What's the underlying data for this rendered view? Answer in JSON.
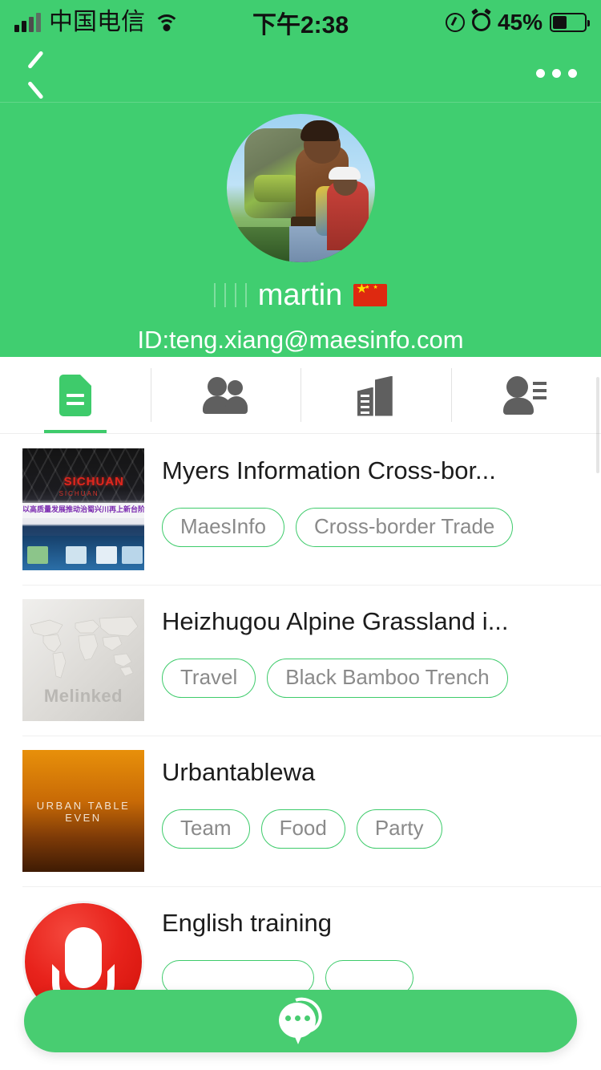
{
  "status_bar": {
    "carrier": "中国电信",
    "time": "下午2:38",
    "battery_percent": "45%",
    "icons": [
      "signal-icon",
      "wifi-icon",
      "location-icon",
      "alarm-icon",
      "battery-icon"
    ]
  },
  "nav_bar": {
    "back_label": "",
    "more_label": ""
  },
  "profile": {
    "username": "martin",
    "flag": "cn-flag",
    "user_id": "ID:teng.xiang@maesinfo.com"
  },
  "tabs": [
    {
      "name": "tab-documents",
      "icon": "document-icon",
      "active": true
    },
    {
      "name": "tab-groups",
      "icon": "people-icon",
      "active": false
    },
    {
      "name": "tab-company",
      "icon": "building-icon",
      "active": false
    },
    {
      "name": "tab-contact",
      "icon": "contact-card-icon",
      "active": false
    }
  ],
  "list": [
    {
      "title": "Myers Information Cross-bor...",
      "thumb": "expo-hall-photo",
      "thumb_logo": "SICHUAN",
      "thumb_banner": "以高质量发展推动治蜀兴川再上新台阶",
      "tags": [
        "MaesInfo",
        "Cross-border Trade"
      ]
    },
    {
      "title": "Heizhugou Alpine Grassland i...",
      "thumb": "world-map-placeholder",
      "thumb_watermark": "Melinked",
      "tags": [
        "Travel",
        "Black Bamboo Trench"
      ]
    },
    {
      "title": "Urbantablewa",
      "thumb": "urban-table-gradient",
      "thumb_caption": "URBAN TABLE EVEN",
      "tags": [
        "Team",
        "Food",
        "Party"
      ]
    },
    {
      "title": "English training",
      "thumb": "microphone-avatar",
      "tags": [
        "",
        ""
      ]
    }
  ],
  "chat_button": {
    "icon": "chat-bubble-icon",
    "label": ""
  },
  "colors": {
    "brand_green": "#40ce70",
    "tab_green": "#3ecb6b",
    "tag_border": "#3ecb6b",
    "tag_text": "#8a8a8a",
    "title_text": "#1c1c1c",
    "fab_green": "#48cd71"
  }
}
